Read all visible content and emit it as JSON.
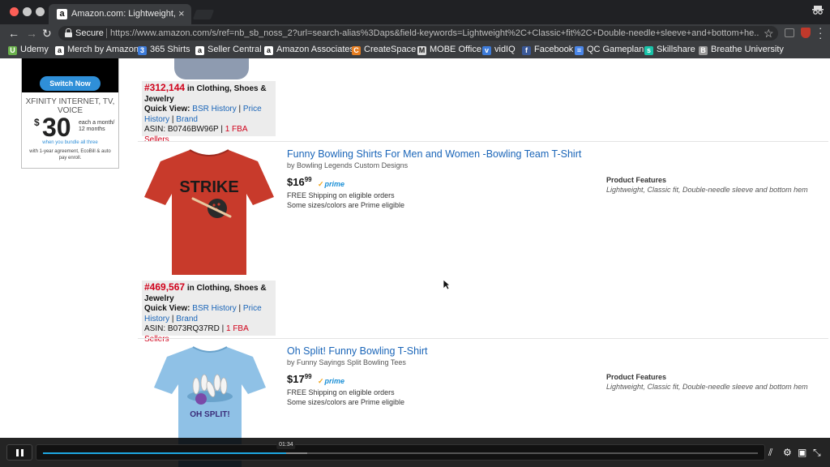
{
  "browser": {
    "tab_title": "Amazon.com: Lightweight, Cla",
    "secure_label": "Secure",
    "url": "https://www.amazon.com/s/ref=nb_sb_noss_2?url=search-alias%3Daps&field-keywords=Lightweight%2C+Classic+fit%2C+Double-needle+sleeve+and+bottom+he...",
    "bookmarks": [
      {
        "label": "Udemy",
        "icon": "udemy-icon",
        "color": "#6ab04c",
        "glyph": "U"
      },
      {
        "label": "Merch by Amazon",
        "icon": "amazon-icon",
        "color": "#ffffff",
        "glyph": "a"
      },
      {
        "label": "365 Shirts",
        "icon": "shirt-icon",
        "color": "#3d7bd9",
        "glyph": "3"
      },
      {
        "label": "Seller Central",
        "icon": "amazon-icon",
        "color": "#ffffff",
        "glyph": "a"
      },
      {
        "label": "Amazon Associates",
        "icon": "amazon-icon",
        "color": "#ffffff",
        "glyph": "a"
      },
      {
        "label": "CreateSpace",
        "icon": "createspace-icon",
        "color": "#e67e22",
        "glyph": "C"
      },
      {
        "label": "MOBE Office",
        "icon": "mobe-icon",
        "color": "#dddddd",
        "glyph": "M"
      },
      {
        "label": "vidIQ",
        "icon": "vidiq-icon",
        "color": "#3d7bd9",
        "glyph": "v"
      },
      {
        "label": "Facebook",
        "icon": "facebook-icon",
        "color": "#3b5998",
        "glyph": "f"
      },
      {
        "label": "QC Gameplan",
        "icon": "doc-icon",
        "color": "#4a86e8",
        "glyph": "≡"
      },
      {
        "label": "Skillshare",
        "icon": "skillshare-icon",
        "color": "#19c2a8",
        "glyph": "s"
      },
      {
        "label": "Breathe University",
        "icon": "breathe-icon",
        "color": "#999999",
        "glyph": "B"
      }
    ]
  },
  "ad": {
    "button": "Switch Now",
    "headline": "XFINITY INTERNET, TV, VOICE",
    "dollar": "$",
    "price": "30",
    "unit": "each a month/ 12 months",
    "note1": "when you bundle all three",
    "note2": "with 1-year agreement, EcoBill & auto pay enroll."
  },
  "products": [
    {
      "rank": "#312,144",
      "category": " in Clothing, Shoes & Jewelry",
      "quick_view": "Quick View: ",
      "bsr_history": "BSR History",
      "sep1": " | ",
      "price_history": "Price History",
      "sep2": " | ",
      "brand_link": "Brand",
      "asin": "ASIN: B0746BW96P",
      "sep3": " | ",
      "fba": "1 FBA Sellers"
    },
    {
      "title": "Funny Bowling Shirts For Men and Women -Bowling Team T-Shirt",
      "brand": "by Bowling Legends Custom Designs",
      "price_dollars": "$16",
      "price_cents": "99",
      "prime": "prime",
      "shipping1": "FREE Shipping on eligible orders",
      "shipping2": "Some sizes/colors are Prime eligible",
      "features_label": "Product Features",
      "features": "Lightweight, Classic fit, Double-needle sleeve and bottom hem",
      "shirt_text": "STRIKE",
      "shirt_color": "#c83a2b",
      "rank": "#469,567",
      "category": " in Clothing, Shoes & Jewelry",
      "quick_view": "Quick View: ",
      "bsr_history": "BSR History",
      "sep1": " | ",
      "price_history": "Price History",
      "sep2": " | ",
      "brand_link": "Brand",
      "asin": "ASIN: B073RQ37RD",
      "sep3": " | ",
      "fba": "1 FBA Sellers"
    },
    {
      "title": "Oh Split! Funny Bowling T-Shirt",
      "brand": "by Funny Sayings Split Bowling Tees",
      "price_dollars": "$17",
      "price_cents": "99",
      "prime": "prime",
      "shipping1": "FREE Shipping on eligible orders",
      "shipping2": "Some sizes/colors are Prime eligible",
      "features_label": "Product Features",
      "features": "Lightweight, Classic fit, Double-needle sleeve and bottom hem",
      "shirt_text": "OH SPLIT!",
      "shirt_color": "#8fc1e6"
    }
  ],
  "player": {
    "time": "01:34",
    "progress": 0.34,
    "buffered": 0.37
  }
}
